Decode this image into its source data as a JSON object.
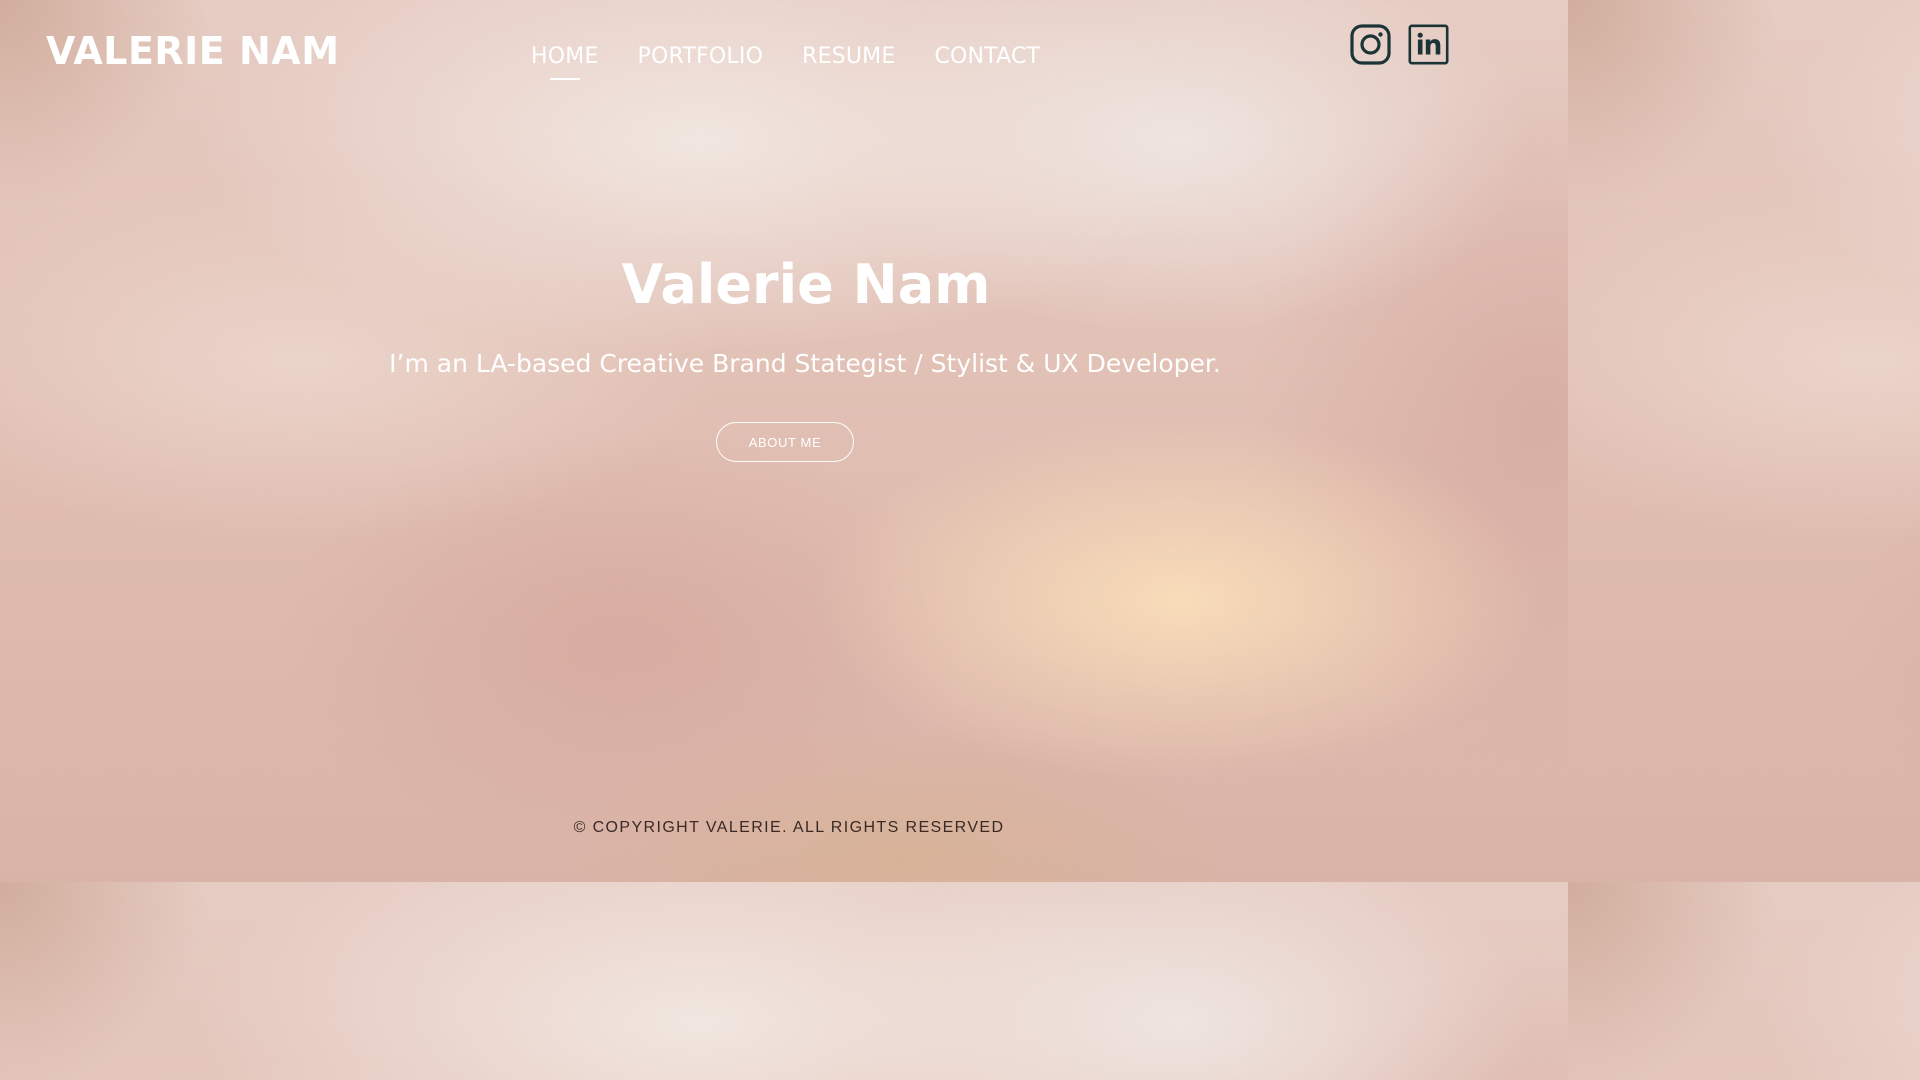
{
  "header": {
    "logo_text": "VALERIE NAM",
    "nav": [
      {
        "label": "HOME",
        "active": true
      },
      {
        "label": "PORTFOLIO",
        "active": false
      },
      {
        "label": "RESUME",
        "active": false
      },
      {
        "label": "CONTACT",
        "active": false
      }
    ],
    "social": [
      {
        "name": "instagram-icon"
      },
      {
        "name": "linkedin-icon"
      }
    ]
  },
  "hero": {
    "title": "Valerie Nam",
    "subtitle": "I’m an LA-based Creative Brand Stategist / Stylist & UX Developer.",
    "button_label": "ABOUT ME"
  },
  "footer": {
    "copyright": "© COPYRIGHT VALERIE. ALL RIGHTS RESERVED"
  },
  "colors": {
    "text_primary": "#ffffff",
    "icon_color": "#1c3436",
    "footer_text": "#3a2a26"
  }
}
